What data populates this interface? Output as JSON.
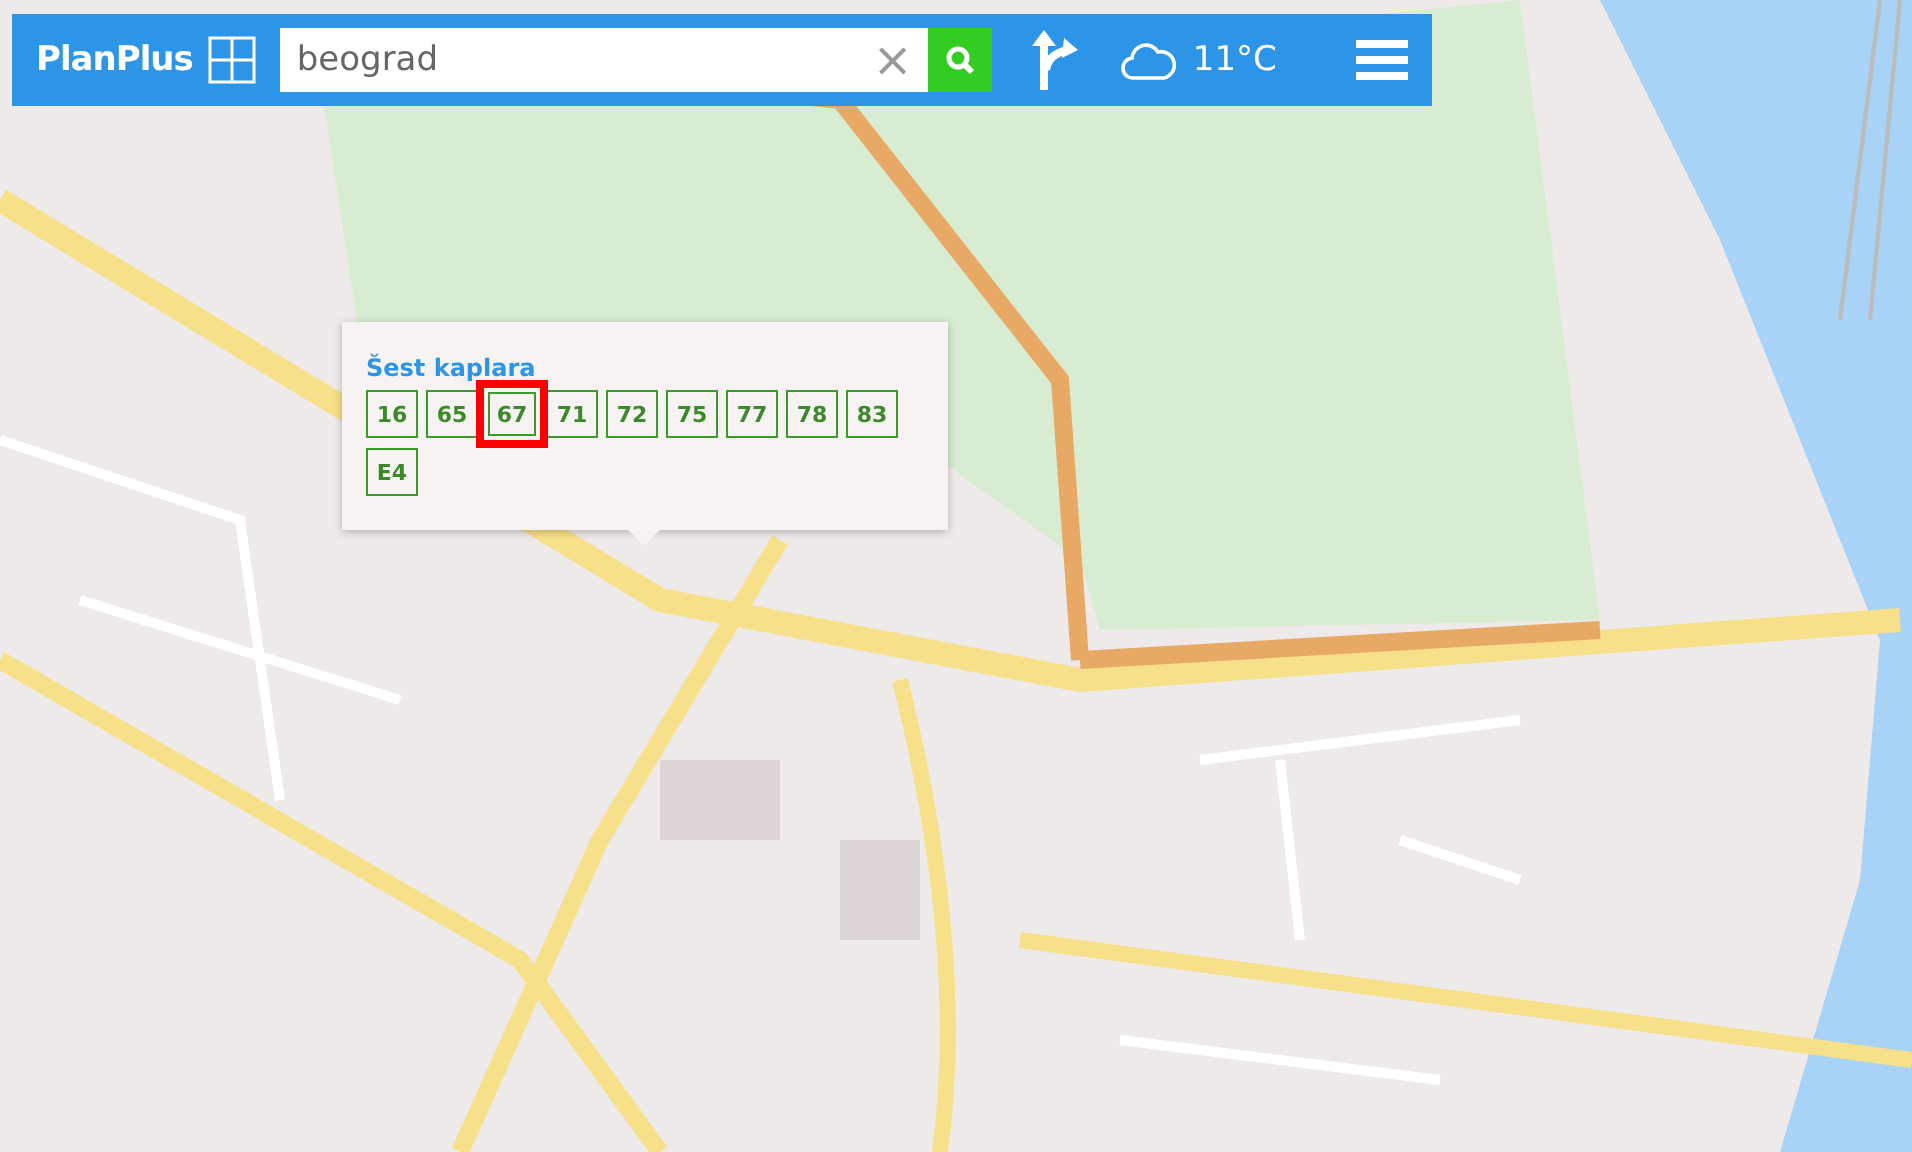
{
  "toolbar": {
    "logo": "PlanPlus",
    "search": {
      "value": "beograd",
      "clear": "×"
    },
    "weather": {
      "temperature": "11°C"
    }
  },
  "popup": {
    "title": "Šest kaplara",
    "lines": [
      {
        "label": "16",
        "selected": false
      },
      {
        "label": "65",
        "selected": false
      },
      {
        "label": "67",
        "selected": true
      },
      {
        "label": "71",
        "selected": false
      },
      {
        "label": "72",
        "selected": false
      },
      {
        "label": "75",
        "selected": false
      },
      {
        "label": "77",
        "selected": false
      },
      {
        "label": "78",
        "selected": false
      },
      {
        "label": "83",
        "selected": false
      },
      {
        "label": "E4",
        "selected": false
      }
    ]
  }
}
